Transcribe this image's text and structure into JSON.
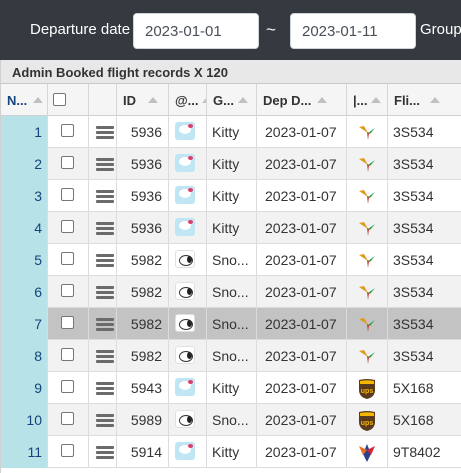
{
  "filter": {
    "departure_label": "Departure date",
    "date_from": "2023-01-01",
    "separator": "~",
    "date_to": "2023-01-11",
    "group_label": "Group"
  },
  "grid": {
    "caption": "Admin Booked flight records X 120",
    "columns": {
      "num": "N...",
      "id": "ID",
      "avatar": "@...",
      "group": "G...",
      "dep_date": "Dep D...",
      "airline": "|...",
      "flight": "Fli..."
    },
    "selected_row": 7,
    "rows": [
      {
        "n": "1",
        "id": "5936",
        "avatar": "kitty-avatar",
        "group": "Kitty",
        "date": "2023-01-07",
        "airline": "hummingbird-logo",
        "flight": "3S534"
      },
      {
        "n": "2",
        "id": "5936",
        "avatar": "kitty-avatar",
        "group": "Kitty",
        "date": "2023-01-07",
        "airline": "hummingbird-logo",
        "flight": "3S534"
      },
      {
        "n": "3",
        "id": "5936",
        "avatar": "kitty-avatar",
        "group": "Kitty",
        "date": "2023-01-07",
        "airline": "hummingbird-logo",
        "flight": "3S534"
      },
      {
        "n": "4",
        "id": "5936",
        "avatar": "kitty-avatar",
        "group": "Kitty",
        "date": "2023-01-07",
        "airline": "hummingbird-logo",
        "flight": "3S534"
      },
      {
        "n": "5",
        "id": "5982",
        "avatar": "snoopy-avatar",
        "group": "Sno...",
        "date": "2023-01-07",
        "airline": "hummingbird-logo",
        "flight": "3S534"
      },
      {
        "n": "6",
        "id": "5982",
        "avatar": "snoopy-avatar",
        "group": "Sno...",
        "date": "2023-01-07",
        "airline": "hummingbird-logo",
        "flight": "3S534"
      },
      {
        "n": "7",
        "id": "5982",
        "avatar": "snoopy-avatar",
        "group": "Sno...",
        "date": "2023-01-07",
        "airline": "hummingbird-logo",
        "flight": "3S534"
      },
      {
        "n": "8",
        "id": "5982",
        "avatar": "snoopy-avatar",
        "group": "Sno...",
        "date": "2023-01-07",
        "airline": "hummingbird-logo",
        "flight": "3S534"
      },
      {
        "n": "9",
        "id": "5943",
        "avatar": "kitty-avatar",
        "group": "Kitty",
        "date": "2023-01-07",
        "airline": "ups-logo",
        "flight": "5X168"
      },
      {
        "n": "10",
        "id": "5989",
        "avatar": "snoopy-avatar",
        "group": "Sno...",
        "date": "2023-01-07",
        "airline": "ups-logo",
        "flight": "5X168"
      },
      {
        "n": "11",
        "id": "5914",
        "avatar": "kitty-avatar",
        "group": "Kitty",
        "date": "2023-01-07",
        "airline": "phoenix-logo",
        "flight": "9T8402"
      }
    ]
  },
  "colors": {
    "topbar": "#343a40",
    "row_number_bg": "#b7e2e7",
    "row_number_text": "#15447d",
    "selected_row_bg": "#c3c3c3",
    "alt_row_bg": "#f2f2f2"
  }
}
